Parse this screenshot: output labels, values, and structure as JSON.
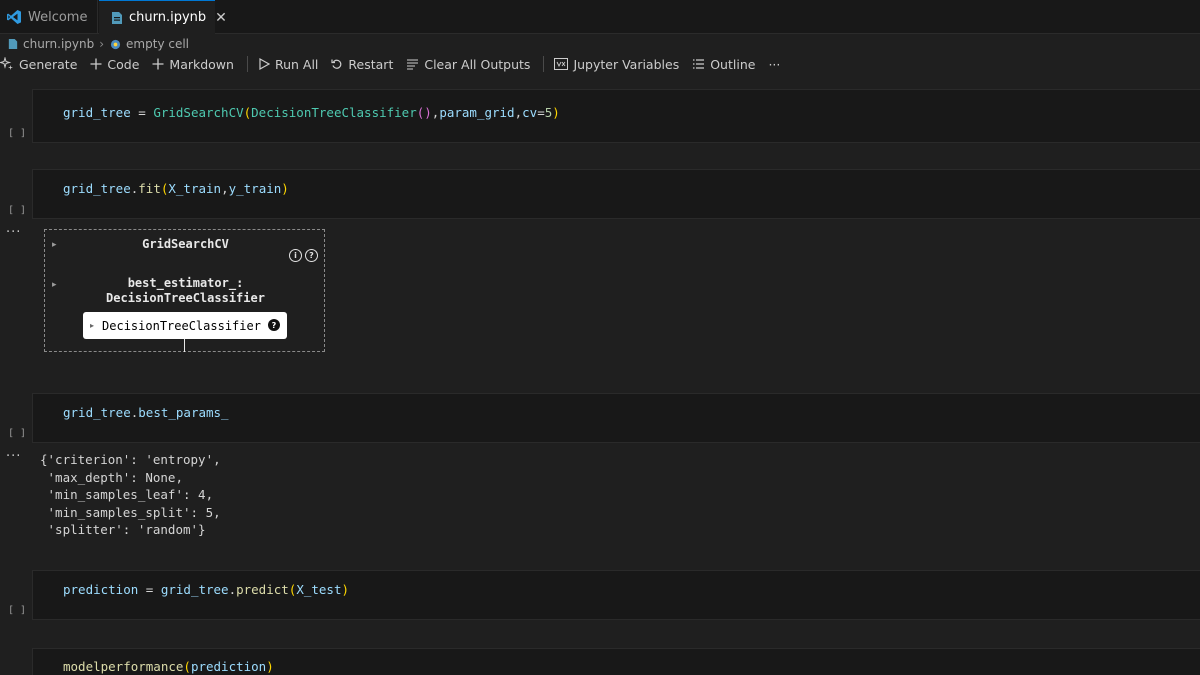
{
  "tabs": [
    {
      "label": "Welcome",
      "icon": "vscode-logo-icon",
      "active": false
    },
    {
      "label": "churn.ipynb",
      "icon": "notebook-file-icon",
      "active": true,
      "close": "✕"
    }
  ],
  "breadcrumb": {
    "file": "churn.ipynb",
    "sep": "›",
    "cell": "empty cell"
  },
  "toolbar": {
    "generate": "Generate",
    "code": "Code",
    "markdown": "Markdown",
    "run_all": "Run All",
    "restart": "Restart",
    "clear": "Clear All Outputs",
    "variables": "Jupyter Variables",
    "outline": "Outline",
    "more": "···"
  },
  "cells": [
    {
      "exec": "[ ]"
    },
    {
      "exec": "[ ]",
      "output_marker": "···"
    },
    {
      "exec": "[ ]",
      "output_marker": "···"
    },
    {
      "exec": "[ ]"
    },
    {
      "exec": ""
    }
  ],
  "widget": {
    "title": "GridSearchCV",
    "info_icon": "i",
    "help_icon": "?",
    "best_label_1": "best_estimator_:",
    "best_label_2": "DecisionTreeClassifier",
    "estimator": "DecisionTreeClassifier",
    "estimator_help": "?"
  },
  "best_params_output": [
    "{'criterion': 'entropy',",
    " 'max_depth': None,",
    " 'min_samples_leaf': 4,",
    " 'min_samples_split': 5,",
    " 'splitter': 'random'}"
  ]
}
